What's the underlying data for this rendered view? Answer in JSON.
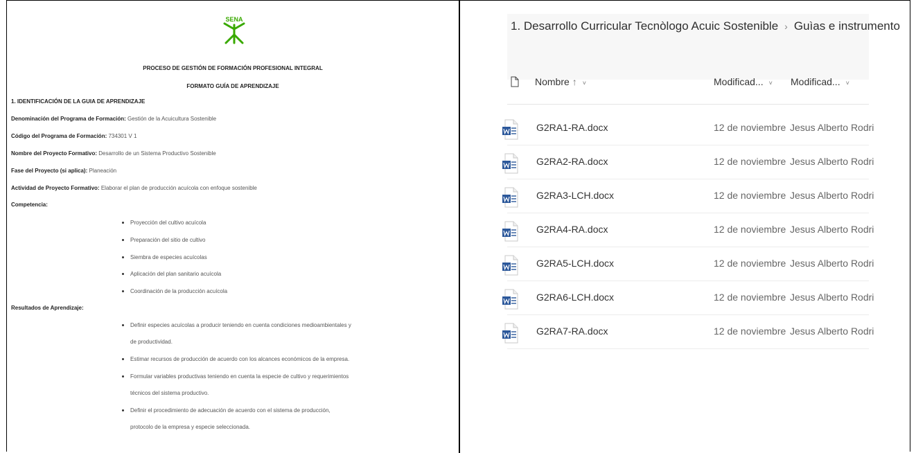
{
  "document": {
    "logo_text": "SENA",
    "title1": "PROCESO DE GESTIÓN DE FORMACIÓN PROFESIONAL INTEGRAL",
    "title2": "FORMATO GUÍA DE APRENDIZAJE",
    "section1": "1. IDENTIFICACIÓN DE LA GUIA DE APRENDIZAJE",
    "fields": [
      {
        "label": "Denominación del Programa de Formación:",
        "value": "Gestión de la Acuicultura Sostenible"
      },
      {
        "label": "Código del Programa de Formación:",
        "value": "734301 V 1"
      },
      {
        "label": "Nombre del Proyecto Formativo:",
        "value": "Desarrollo de un Sistema Productivo Sostenible"
      },
      {
        "label": "Fase del Proyecto (si aplica):",
        "value": "Planeación"
      },
      {
        "label": "Actividad de Proyecto Formativo:",
        "value": "Elaborar el plan de producción acuícola con enfoque sostenible"
      }
    ],
    "competencia_label": "Competencia:",
    "competencias": [
      "Proyección del cultivo acuícola",
      "Preparación del sitio de cultivo",
      "Siembra de especies acuícolas",
      "Aplicación del plan sanitario acuícola",
      "Coordinación de la producción acuícola"
    ],
    "resultados_label": "Resultados de Aprendizaje:",
    "resultados": [
      {
        "text": "Definir especies acuícolas a producir teniendo en cuenta condiciones medioambientales y",
        "cont": "de productividad."
      },
      {
        "text": "Estimar recursos de producción de acuerdo con los alcances económicos de la empresa.",
        "cont": ""
      },
      {
        "text": "Formular variables productivas teniendo en cuenta la especie de cultivo y requerimientos",
        "cont": "técnicos del sistema productivo."
      },
      {
        "text": "Definir el procedimiento de adecuación de acuerdo con el sistema de producción,",
        "cont": "protocolo de la empresa y especie seleccionada."
      }
    ]
  },
  "files": {
    "breadcrumb": [
      "1. Desarrollo Curricular Tecnòlogo Acuic Sostenible",
      "Guìas e instrumento"
    ],
    "breadcrumb_sep": "›",
    "columns": {
      "name": "Nombre",
      "name_sort": "↑",
      "caret": "˅",
      "modified": "Modificad...",
      "modified_by": "Modificad..."
    },
    "icon_color": "#2b579a",
    "rows": [
      {
        "name": "G2RA1-RA.docx",
        "date": "12 de noviembre",
        "user": "Jesus Alberto Rodri"
      },
      {
        "name": "G2RA2-RA.docx",
        "date": "12 de noviembre",
        "user": "Jesus Alberto Rodri"
      },
      {
        "name": "G2RA3-LCH.docx",
        "date": "12 de noviembre",
        "user": "Jesus Alberto Rodri"
      },
      {
        "name": "G2RA4-RA.docx",
        "date": "12 de noviembre",
        "user": "Jesus Alberto Rodri"
      },
      {
        "name": "G2RA5-LCH.docx",
        "date": "12 de noviembre",
        "user": "Jesus Alberto Rodri"
      },
      {
        "name": "G2RA6-LCH.docx",
        "date": "12 de noviembre",
        "user": "Jesus Alberto Rodri"
      },
      {
        "name": "G2RA7-RA.docx",
        "date": "12 de noviembre",
        "user": "Jesus Alberto Rodri"
      }
    ]
  }
}
